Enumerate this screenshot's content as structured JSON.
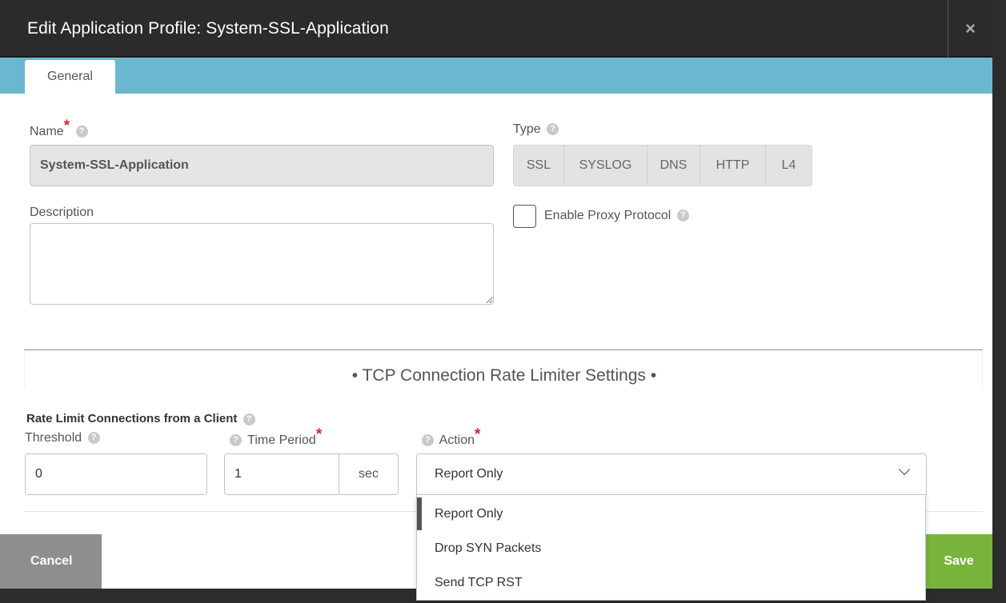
{
  "modal": {
    "title": "Edit Application Profile: System-SSL-Application",
    "close_glyph": "×"
  },
  "tabs": [
    {
      "label": "General",
      "active": true
    }
  ],
  "form": {
    "name": {
      "label": "Name",
      "required_mark": "*",
      "value": "System-SSL-Application"
    },
    "description": {
      "label": "Description",
      "value": ""
    },
    "type": {
      "label": "Type",
      "options": [
        "SSL",
        "SYSLOG",
        "DNS",
        "HTTP",
        "L4"
      ]
    },
    "proxy_protocol": {
      "label": "Enable Proxy Protocol",
      "checked": false
    }
  },
  "tcp_section": {
    "title": "• TCP Connection Rate Limiter Settings •",
    "rate_limit_label": "Rate Limit Connections from a Client",
    "threshold": {
      "label": "Threshold",
      "value": "0"
    },
    "time_period": {
      "label": "Time Period",
      "required_mark": "*",
      "value": "1",
      "unit": "sec"
    },
    "action": {
      "label": "Action",
      "required_mark": "*",
      "selected": "Report Only",
      "options": [
        "Report Only",
        "Drop SYN Packets",
        "Send TCP RST"
      ]
    }
  },
  "footer": {
    "cancel_label": "Cancel",
    "save_label": "Save"
  },
  "icons": {
    "help": "help-icon",
    "close": "close-icon",
    "chevron": "chevron-down-icon"
  },
  "colors": {
    "header_bg": "#2b2b2b",
    "tabbar": "#6ab7cf",
    "save": "#78b43c",
    "cancel": "#8e8e8e",
    "required": "#e8202a"
  }
}
